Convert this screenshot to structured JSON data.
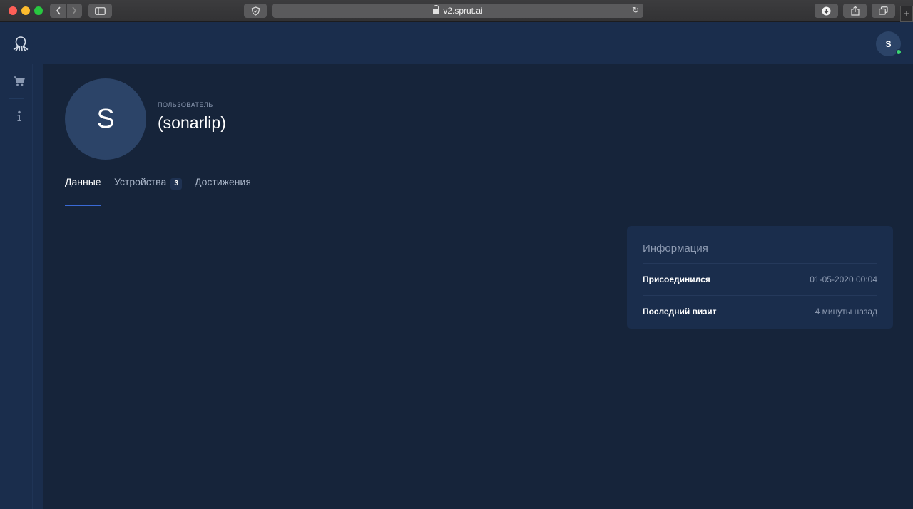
{
  "browser": {
    "url": "v2.sprut.ai"
  },
  "header": {
    "avatar_initial": "S"
  },
  "profile": {
    "avatar_initial": "S",
    "role": "ПОЛЬЗОВАТЕЛЬ",
    "name": "(sonarlip)"
  },
  "tabs": [
    {
      "label": "Данные",
      "active": true
    },
    {
      "label": "Устройства",
      "count": "3",
      "active": false
    },
    {
      "label": "Достижения",
      "active": false
    }
  ],
  "info": {
    "title": "Информация",
    "rows": [
      {
        "label": "Присоединился",
        "value": "01-05-2020 00:04"
      },
      {
        "label": "Последний визит",
        "value": "4 минуты назад"
      }
    ]
  },
  "colors": {
    "background": "#16243a",
    "panel": "#1a2d4c",
    "accent": "#3a6ad6",
    "online": "#3bd671"
  },
  "icons": {
    "logo": "octopus-logo-icon",
    "cart": "cart-icon",
    "info": "info-icon"
  }
}
